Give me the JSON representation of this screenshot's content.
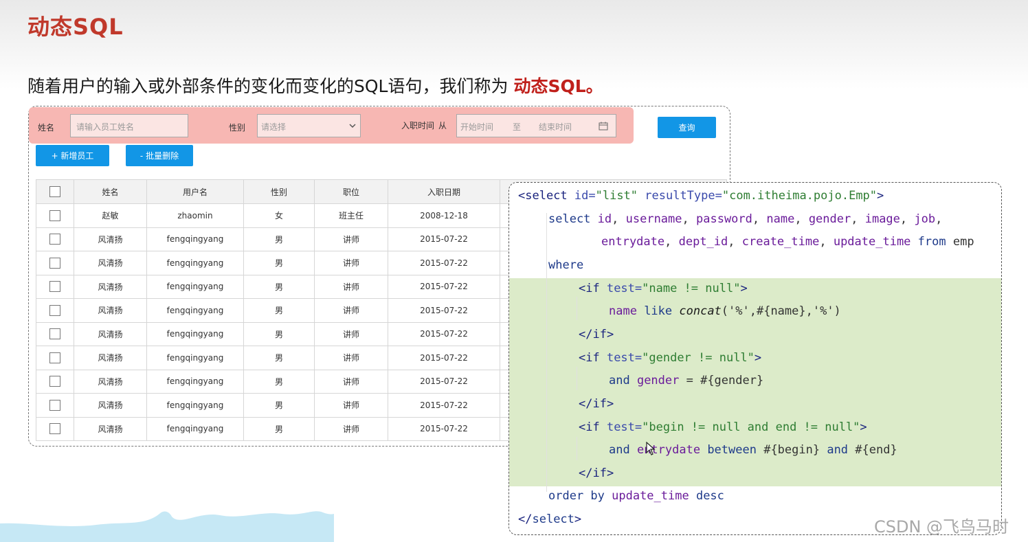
{
  "slide": {
    "title": "动态SQL",
    "subtitle_prefix": "随着用户的输入或外部条件的变化而变化的SQL语句，我们称为 ",
    "subtitle_highlight": "动态SQL。",
    "watermark": "CSDN @飞鸟马时"
  },
  "colors": {
    "title": "#c0392b",
    "highlight": "#c0201b",
    "filter_bar": "#f7b7b3",
    "button": "#1296e6",
    "code_highlight": "#dcebc9"
  },
  "filter": {
    "name_label": "姓名",
    "name_placeholder": "请输入员工姓名",
    "gender_label": "性别",
    "gender_placeholder": "请选择",
    "date_label": "入职时间",
    "date_from": "从",
    "date_start_placeholder": "开始时间",
    "date_to": "至",
    "date_end_placeholder": "结束时间",
    "query_button": "查询"
  },
  "actions": {
    "add_button": "+ 新增员工",
    "batch_delete_button": "- 批量删除"
  },
  "table": {
    "headers": [
      "姓名",
      "用户名",
      "性别",
      "职位",
      "入职日期"
    ],
    "rows": [
      [
        "赵敏",
        "zhaomin",
        "女",
        "班主任",
        "2008-12-18"
      ],
      [
        "风清扬",
        "fengqingyang",
        "男",
        "讲师",
        "2015-07-22"
      ],
      [
        "风清扬",
        "fengqingyang",
        "男",
        "讲师",
        "2015-07-22"
      ],
      [
        "风清扬",
        "fengqingyang",
        "男",
        "讲师",
        "2015-07-22"
      ],
      [
        "风清扬",
        "fengqingyang",
        "男",
        "讲师",
        "2015-07-22"
      ],
      [
        "风清扬",
        "fengqingyang",
        "男",
        "讲师",
        "2015-07-22"
      ],
      [
        "风清扬",
        "fengqingyang",
        "男",
        "讲师",
        "2015-07-22"
      ],
      [
        "风清扬",
        "fengqingyang",
        "男",
        "讲师",
        "2015-07-22"
      ],
      [
        "风清扬",
        "fengqingyang",
        "男",
        "讲师",
        "2015-07-22"
      ],
      [
        "风清扬",
        "fengqingyang",
        "男",
        "讲师",
        "2015-07-22"
      ]
    ]
  },
  "code": {
    "lines": [
      {
        "indent": 0,
        "tokens": [
          [
            "t",
            "<select "
          ],
          [
            "a",
            "id="
          ],
          [
            "s",
            "\"list\" "
          ],
          [
            "a",
            "resultType="
          ],
          [
            "s",
            "\"com.itheima.pojo.Emp\""
          ],
          [
            "t",
            ">"
          ]
        ]
      },
      {
        "indent": 1,
        "tokens": [
          [
            "k",
            "select "
          ],
          [
            "c",
            "id"
          ],
          [
            "p",
            ", "
          ],
          [
            "c",
            "username"
          ],
          [
            "p",
            ", "
          ],
          [
            "c",
            "password"
          ],
          [
            "p",
            ", "
          ],
          [
            "c",
            "name"
          ],
          [
            "p",
            ", "
          ],
          [
            "c",
            "gender"
          ],
          [
            "p",
            ", "
          ],
          [
            "c",
            "image"
          ],
          [
            "p",
            ", "
          ],
          [
            "c",
            "job"
          ],
          [
            "p",
            ","
          ]
        ]
      },
      {
        "indent": 2.75,
        "tokens": [
          [
            "c",
            "entrydate"
          ],
          [
            "p",
            ", "
          ],
          [
            "c",
            "dept_id"
          ],
          [
            "p",
            ", "
          ],
          [
            "c",
            "create_time"
          ],
          [
            "p",
            ", "
          ],
          [
            "c",
            "update_time "
          ],
          [
            "k",
            "from "
          ],
          [
            "p",
            "emp"
          ]
        ]
      },
      {
        "indent": 1,
        "tokens": [
          [
            "k",
            "where"
          ]
        ]
      },
      {
        "indent": 2,
        "tokens": [
          [
            "t",
            "<if "
          ],
          [
            "a",
            "test="
          ],
          [
            "s",
            "\"name != null\""
          ],
          [
            "t",
            ">"
          ]
        ]
      },
      {
        "indent": 3,
        "tokens": [
          [
            "c",
            "name "
          ],
          [
            "k",
            "like "
          ],
          [
            "fn",
            "concat"
          ],
          [
            "p",
            "('%',#{name},'%')"
          ]
        ]
      },
      {
        "indent": 2,
        "tokens": [
          [
            "t",
            "</if>"
          ]
        ]
      },
      {
        "indent": 2,
        "tokens": [
          [
            "t",
            "<if "
          ],
          [
            "a",
            "test="
          ],
          [
            "s",
            "\"gender != null\""
          ],
          [
            "t",
            ">"
          ]
        ]
      },
      {
        "indent": 3,
        "tokens": [
          [
            "k",
            "and "
          ],
          [
            "c",
            "gender "
          ],
          [
            "p",
            "= #{gender}"
          ]
        ]
      },
      {
        "indent": 2,
        "tokens": [
          [
            "t",
            "</if>"
          ]
        ]
      },
      {
        "indent": 2,
        "tokens": [
          [
            "t",
            "<if "
          ],
          [
            "a",
            "test="
          ],
          [
            "s",
            "\"begin != null and end != null\""
          ],
          [
            "t",
            ">"
          ]
        ]
      },
      {
        "indent": 3,
        "tokens": [
          [
            "k",
            "and "
          ],
          [
            "c",
            "entrydate "
          ],
          [
            "k",
            "between "
          ],
          [
            "p",
            "#{begin} "
          ],
          [
            "k",
            "and "
          ],
          [
            "p",
            "#{end}"
          ]
        ]
      },
      {
        "indent": 2,
        "tokens": [
          [
            "t",
            "</if>"
          ]
        ]
      },
      {
        "indent": 1,
        "tokens": [
          [
            "k",
            "order by "
          ],
          [
            "c",
            "update_time "
          ],
          [
            "k",
            "desc"
          ]
        ]
      },
      {
        "indent": 0,
        "tokens": [
          [
            "t",
            "</"
          ],
          [
            "k",
            "select"
          ],
          [
            "t",
            ">"
          ]
        ]
      }
    ]
  }
}
